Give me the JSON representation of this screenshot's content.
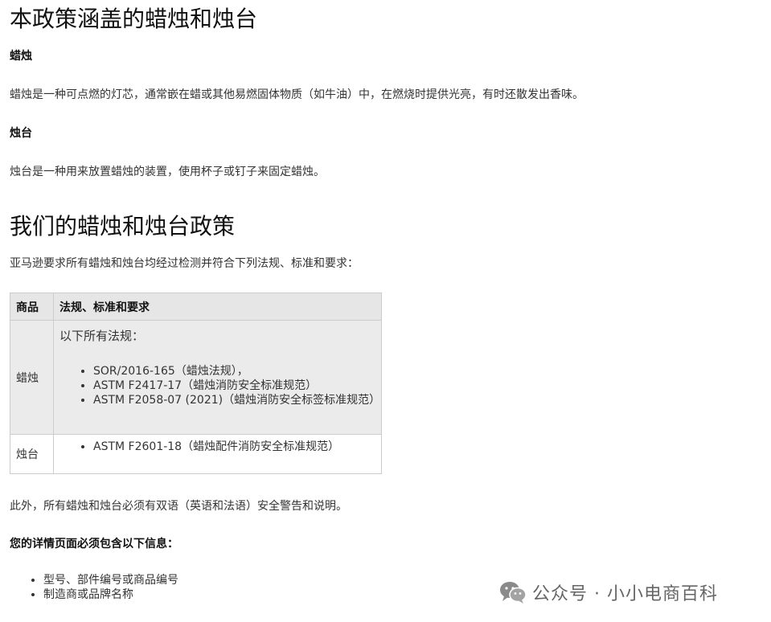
{
  "section1": {
    "title": "本政策涵盖的蜡烛和烛台",
    "candle_heading": "蜡烛",
    "candle_desc": "蜡烛是一种可点燃的灯芯，通常嵌在蜡或其他易燃固体物质（如牛油）中，在燃烧时提供光亮，有时还散发出香味。",
    "holder_heading": "烛台",
    "holder_desc": "烛台是一种用来放置蜡烛的装置，使用杯子或钉子来固定蜡烛。"
  },
  "section2": {
    "title": "我们的蜡烛和烛台政策",
    "intro": "亚马逊要求所有蜡烛和烛台均经过检测并符合下列法规、标准和要求：",
    "table": {
      "headers": [
        "商品",
        "法规、标准和要求"
      ],
      "rows": [
        {
          "product": "蜡烛",
          "intro": "以下所有法规：",
          "items": [
            "SOR/2016-165（蜡烛法规），",
            "ASTM F2417-17（蜡烛消防安全标准规范）",
            "ASTM F2058-07 (2021)（蜡烛消防安全标签标准规范）"
          ]
        },
        {
          "product": "烛台",
          "items": [
            "ASTM F2601-18（蜡烛配件消防安全标准规范）"
          ]
        }
      ]
    },
    "warning": "此外，所有蜡烛和烛台必须有双语（英语和法语）安全警告和说明。",
    "detail_heading": "您的详情页面必须包含以下信息：",
    "detail_items": [
      "型号、部件编号或商品编号",
      "制造商或品牌名称"
    ]
  },
  "watermark": {
    "text": "公众号 · 小小电商百科",
    "icon": "wechat-icon"
  }
}
